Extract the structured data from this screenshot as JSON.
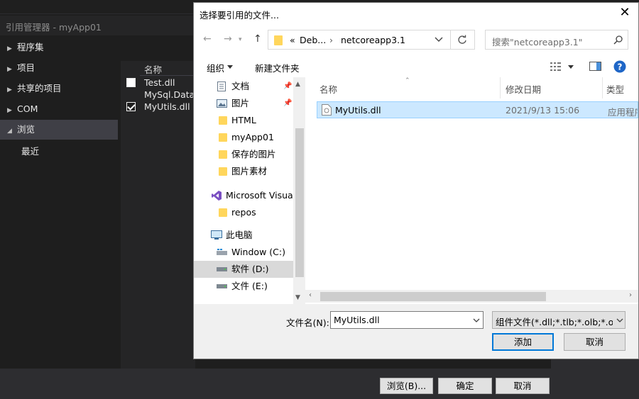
{
  "ref_manager": {
    "title": "引用管理器 - myApp01",
    "nav": [
      {
        "label": "程序集",
        "expanded": false
      },
      {
        "label": "项目",
        "expanded": false
      },
      {
        "label": "共享的项目",
        "expanded": false
      },
      {
        "label": "COM",
        "expanded": false
      },
      {
        "label": "浏览",
        "expanded": true
      },
      {
        "label": "最近"
      }
    ],
    "list_header": "名称",
    "files": [
      {
        "name": "Test.dll",
        "checked": false
      },
      {
        "name": "MySql.Data.",
        "checked": null
      },
      {
        "name": "MyUtils.dll",
        "checked": true
      }
    ],
    "buttons": {
      "browse": "浏览(B)...",
      "ok": "确定",
      "cancel": "取消"
    }
  },
  "dialog": {
    "title": "选择要引用的文件...",
    "close_glyph": "✕",
    "path": {
      "overflow": "«",
      "segments": [
        "Deb...",
        "netcoreapp3.1"
      ],
      "separator": "›"
    },
    "search_placeholder": "搜索\"netcoreapp3.1\"",
    "toolbar": {
      "organize": "组织",
      "new_folder": "新建文件夹"
    },
    "nav_pane": [
      {
        "label": "文档",
        "icon": "document-icon",
        "pinned": true
      },
      {
        "label": "图片",
        "icon": "picture-icon",
        "pinned": true
      },
      {
        "label": "HTML",
        "icon": "folder-icon"
      },
      {
        "label": "myApp01",
        "icon": "folder-icon"
      },
      {
        "label": "保存的图片",
        "icon": "folder-icon"
      },
      {
        "label": "图片素材",
        "icon": "folder-icon"
      },
      {
        "label": "Microsoft Visual",
        "icon": "visual-studio-icon"
      },
      {
        "label": "repos",
        "icon": "folder-icon"
      },
      {
        "label": "此电脑",
        "icon": "computer-icon"
      },
      {
        "label": "Window (C:)",
        "icon": "windows-drive-icon"
      },
      {
        "label": "软件 (D:)",
        "icon": "drive-icon",
        "selected": true
      },
      {
        "label": "文件 (E:)",
        "icon": "drive-icon"
      }
    ],
    "columns": [
      "名称",
      "修改日期",
      "类型"
    ],
    "files": [
      {
        "name": "MyUtils.dll",
        "modified": "2021/9/13 15:06",
        "type": "应用程序",
        "selected": true
      }
    ],
    "file_name_label": "文件名(N):",
    "file_name_value": "MyUtils.dll",
    "file_type_value": "组件文件(*.dll;*.tlb;*.olb;*.ocx;",
    "open_button": "添加",
    "cancel_button": "取消"
  },
  "colors": {
    "accent": "#0078d7",
    "selection": "#cce8ff",
    "folder": "#ffd65c",
    "dark_bg": "#1e1e1e"
  }
}
